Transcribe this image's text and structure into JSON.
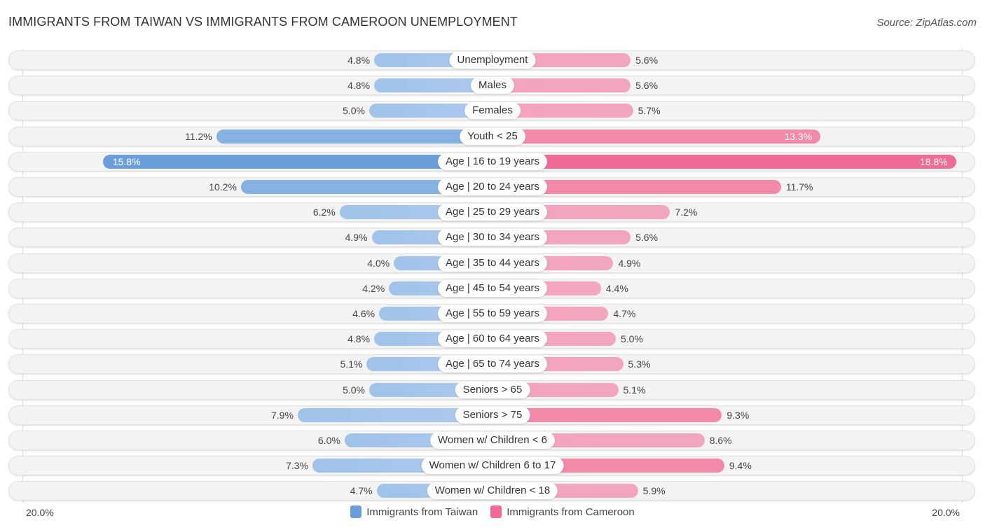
{
  "header": {
    "title": "IMMIGRANTS FROM TAIWAN VS IMMIGRANTS FROM CAMEROON UNEMPLOYMENT",
    "source": "Source: ZipAtlas.com"
  },
  "colors": {
    "taiwan": "#6a9fdc",
    "cameroon": "#f06b96",
    "taiwan_light": "#a8c8ec",
    "cameroon_light": "#f4a7bf"
  },
  "chart_data": {
    "type": "bar",
    "orientation": "diverging-horizontal",
    "title": "IMMIGRANTS FROM TAIWAN VS IMMIGRANTS FROM CAMEROON UNEMPLOYMENT",
    "categories": [
      "Unemployment",
      "Males",
      "Females",
      "Youth < 25",
      "Age | 16 to 19 years",
      "Age | 20 to 24 years",
      "Age | 25 to 29 years",
      "Age | 30 to 34 years",
      "Age | 35 to 44 years",
      "Age | 45 to 54 years",
      "Age | 55 to 59 years",
      "Age | 60 to 64 years",
      "Age | 65 to 74 years",
      "Seniors > 65",
      "Seniors > 75",
      "Women w/ Children < 6",
      "Women w/ Children 6 to 17",
      "Women w/ Children < 18"
    ],
    "series": [
      {
        "name": "Immigrants from Taiwan",
        "side": "left",
        "values": [
          4.8,
          4.8,
          5.0,
          11.2,
          15.8,
          10.2,
          6.2,
          4.9,
          4.0,
          4.2,
          4.6,
          4.8,
          5.1,
          5.0,
          7.9,
          6.0,
          7.3,
          4.7
        ],
        "labels": [
          "4.8%",
          "4.8%",
          "5.0%",
          "11.2%",
          "15.8%",
          "10.2%",
          "6.2%",
          "4.9%",
          "4.0%",
          "4.2%",
          "4.6%",
          "4.8%",
          "5.1%",
          "5.0%",
          "7.9%",
          "6.0%",
          "7.3%",
          "4.7%"
        ]
      },
      {
        "name": "Immigrants from Cameroon",
        "side": "right",
        "values": [
          5.6,
          5.6,
          5.7,
          13.3,
          18.8,
          11.7,
          7.2,
          5.6,
          4.9,
          4.4,
          4.7,
          5.0,
          5.3,
          5.1,
          9.3,
          8.6,
          9.4,
          5.9
        ],
        "labels": [
          "5.6%",
          "5.6%",
          "5.7%",
          "13.3%",
          "18.8%",
          "11.7%",
          "7.2%",
          "5.6%",
          "4.9%",
          "4.4%",
          "4.7%",
          "5.0%",
          "5.3%",
          "5.1%",
          "9.3%",
          "8.6%",
          "9.4%",
          "5.9%"
        ]
      }
    ],
    "xlim": [
      -20,
      20
    ],
    "axis_labels": {
      "left": "20.0%",
      "right": "20.0%"
    },
    "legend": [
      "Immigrants from Taiwan",
      "Immigrants from Cameroon"
    ],
    "legend_position": "bottom-center",
    "unit": "%"
  }
}
